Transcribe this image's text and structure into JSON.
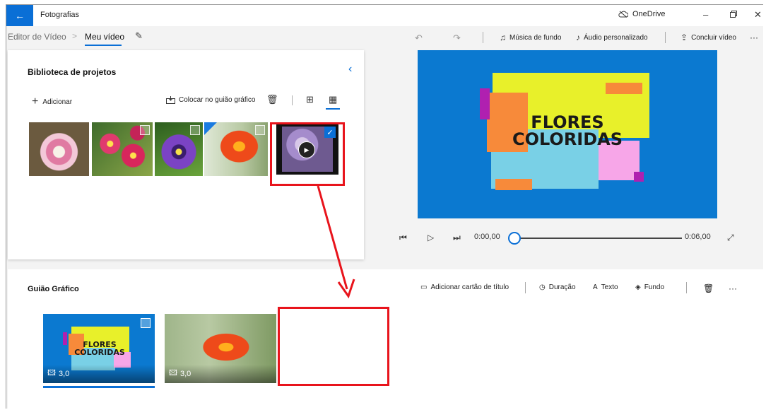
{
  "titlebar": {
    "back_icon": "←",
    "app_title": "Fotografias",
    "onedrive_label": "OneDrive",
    "minimize_icon": "–",
    "restore_icon": "▫",
    "close_icon": "✕"
  },
  "breadcrumb": {
    "parent": "Editor de Vídeo",
    "separator": ">",
    "current": "Meu vídeo"
  },
  "toolbar": {
    "undo_icon": "↶",
    "redo_icon": "↷",
    "music_label": "Música de fundo",
    "audio_label": "Áudio personalizado",
    "finish_label": "Concluir vídeo",
    "more_icon": "···"
  },
  "library": {
    "title": "Biblioteca de projetos",
    "add_label": "Adicionar",
    "place_label": "Colocar no guião gráfico",
    "collapse_icon": "‹"
  },
  "preview": {
    "title_line1": "FLORES",
    "title_line2": "COLORIDAS",
    "time_current": "0:00,00",
    "time_total": "0:06,00"
  },
  "storyboard": {
    "title": "Guião Gráfico",
    "add_title_card_label": "Adicionar cartão de título",
    "duration_label": "Duração",
    "text_label": "Texto",
    "background_label": "Fundo",
    "more_icon": "···",
    "cards": [
      {
        "duration": "3,0",
        "title_line1": "FLORES",
        "title_line2": "COLORIDAS"
      },
      {
        "duration": "3,0"
      }
    ]
  },
  "colors": {
    "accent": "#0a6fd6",
    "annotation_red": "#e8141c",
    "preview_bg": "#0b79d0"
  }
}
